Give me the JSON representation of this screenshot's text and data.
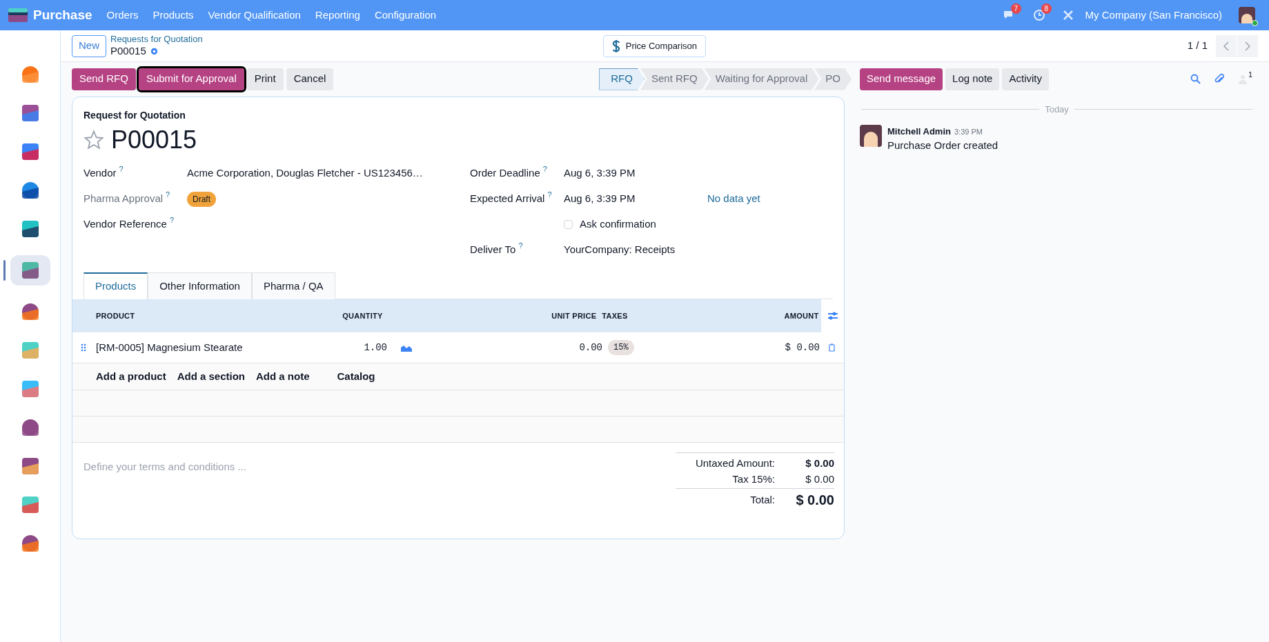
{
  "navbar": {
    "app_name": "Purchase",
    "menu": [
      "Orders",
      "Products",
      "Vendor Qualification",
      "Reporting",
      "Configuration"
    ],
    "messages_count": "7",
    "activities_count": "8",
    "company": "My Company (San Francisco)"
  },
  "sidebar": {
    "apps": [
      {
        "selected": false
      },
      {
        "selected": false
      },
      {
        "selected": false
      },
      {
        "selected": false
      },
      {
        "selected": false
      },
      {
        "selected": true
      },
      {
        "selected": false
      },
      {
        "selected": false
      },
      {
        "selected": false
      },
      {
        "selected": false
      },
      {
        "selected": false
      },
      {
        "selected": false
      },
      {
        "selected": false
      }
    ]
  },
  "control_panel": {
    "new_button": "New",
    "breadcrumb": "Requests for Quotation",
    "record_name": "P00015",
    "smart_button": "Price Comparison",
    "pager": "1 / 1"
  },
  "actions": [
    {
      "label": "Send RFQ",
      "kind": "primary",
      "focused": false
    },
    {
      "label": "Submit for Approval",
      "kind": "primary",
      "focused": true
    },
    {
      "label": "Print",
      "kind": "secondary",
      "focused": false
    },
    {
      "label": "Cancel",
      "kind": "secondary",
      "focused": false
    }
  ],
  "statusbar": [
    {
      "label": "RFQ",
      "selected": true
    },
    {
      "label": "Sent RFQ",
      "selected": false
    },
    {
      "label": "Waiting for Approval",
      "selected": false
    },
    {
      "label": "PO",
      "selected": false
    }
  ],
  "form": {
    "subtitle": "Request for Quotation",
    "title": "P00015",
    "starred": false,
    "left_fields": [
      {
        "label": "Vendor",
        "help": "?",
        "value": "Acme Corporation, Douglas Fletcher - US123456…",
        "kind": "text",
        "muted": false
      },
      {
        "label": "Pharma Approval",
        "help": "?",
        "value": "Draft",
        "kind": "badge",
        "muted": true
      },
      {
        "label": "Vendor Reference",
        "help": "?",
        "kind": "empty",
        "muted": false
      }
    ],
    "right_fields": [
      {
        "label": "Order Deadline",
        "help": "?",
        "value": "Aug 6, 3:39 PM",
        "kind": "text"
      },
      {
        "label": "Expected Arrival",
        "help": "?",
        "value": "Aug 6, 3:39 PM",
        "extra": "No data yet",
        "kind": "text"
      },
      {
        "label": "Ask confirmation",
        "checked": false,
        "kind": "checkbox"
      },
      {
        "label": "Deliver To",
        "help": "?",
        "value": "YourCompany: Receipts",
        "kind": "text"
      }
    ],
    "tabs": [
      {
        "label": "Products",
        "selected": true
      },
      {
        "label": "Other Information",
        "selected": false
      },
      {
        "label": "Pharma / QA",
        "selected": false
      }
    ],
    "table": {
      "columns": [
        "PRODUCT",
        "QUANTITY",
        "UNIT PRICE",
        "TAXES",
        "AMOUNT"
      ],
      "rows": [
        {
          "product": "[RM-0005] Magnesium Stearate",
          "quantity": "1.00",
          "unit_price": "0.00",
          "taxes": "15%",
          "amount": "$ 0.00"
        }
      ],
      "add_links": [
        "Add a product",
        "Add a section",
        "Add a note",
        "Catalog"
      ]
    },
    "terms_placeholder": "Define your terms and conditions ...",
    "totals": [
      {
        "label": "Untaxed Amount:",
        "value": "$ 0.00",
        "kind": "bold"
      },
      {
        "label": "Tax 15%:",
        "value": "$ 0.00",
        "kind": "normal"
      },
      {
        "label": "Total:",
        "value": "$ 0.00",
        "kind": "grand"
      }
    ]
  },
  "chatter": {
    "buttons": [
      {
        "label": "Send message",
        "kind": "primary"
      },
      {
        "label": "Log note",
        "kind": "secondary"
      },
      {
        "label": "Activity",
        "kind": "secondary"
      }
    ],
    "followers_count": "1",
    "date_separator": "Today",
    "messages": [
      {
        "author": "Mitchell Admin",
        "time": "3:39 PM",
        "body": "Purchase Order created"
      }
    ]
  }
}
